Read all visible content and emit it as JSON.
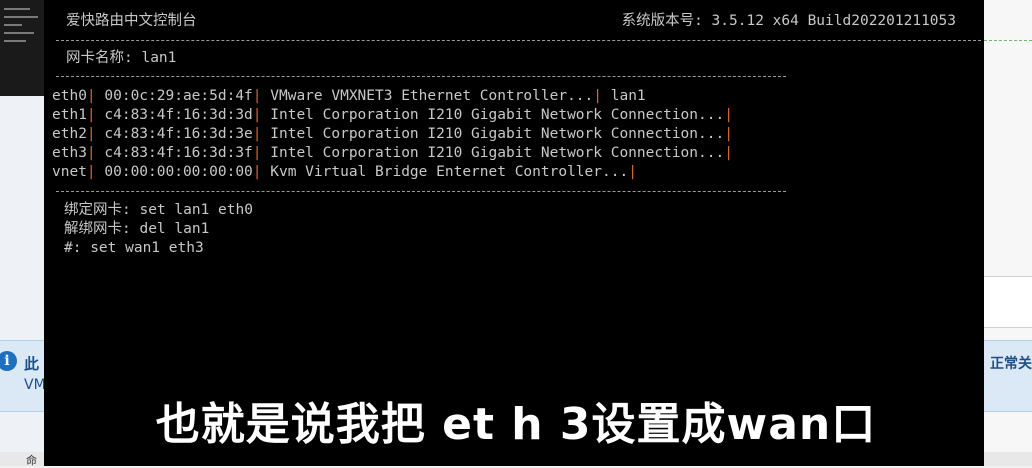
{
  "host": {
    "info_title": "此",
    "info_sub": "VM",
    "info_right": "正常关",
    "bottom_tab": "命"
  },
  "console": {
    "title": "爱快路由中文控制台",
    "version_label": "系统版本号: 3.5.12 x64 Build202201211053",
    "nic_name_label": "网卡名称: lan1",
    "nics": [
      {
        "name": "eth0",
        "mac": "00:0c:29:ae:5d:4f",
        "desc": "VMware VMXNET3 Ethernet Controller...",
        "bind": "lan1"
      },
      {
        "name": "eth1",
        "mac": "c4:83:4f:16:3d:3d",
        "desc": "Intel Corporation I210 Gigabit Network Connection...",
        "bind": ""
      },
      {
        "name": "eth2",
        "mac": "c4:83:4f:16:3d:3e",
        "desc": "Intel Corporation I210 Gigabit Network Connection...",
        "bind": ""
      },
      {
        "name": "eth3",
        "mac": "c4:83:4f:16:3d:3f",
        "desc": "Intel Corporation I210 Gigabit Network Connection...",
        "bind": ""
      },
      {
        "name": "vnet",
        "mac": "00:00:00:00:00:00",
        "desc": "Kvm Virtual Bridge Enternet Controller...",
        "bind": ""
      }
    ],
    "bind_hint": "绑定网卡: set lan1 eth0",
    "unbind_hint": "解绑网卡: del lan1",
    "prompt": "#: set wan1 eth3",
    "separator": "|"
  },
  "subtitle": "也就是说我把 et h 3设置成wan口"
}
